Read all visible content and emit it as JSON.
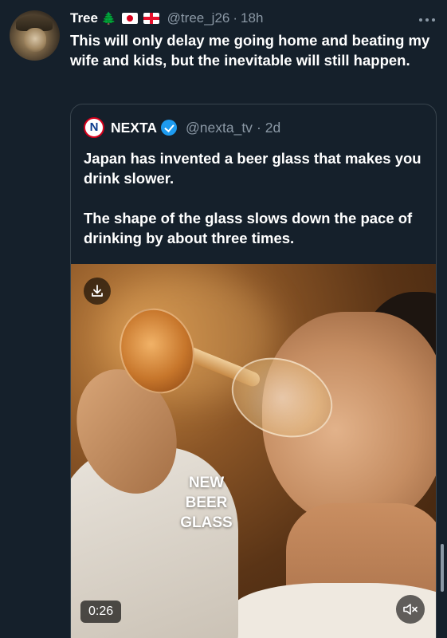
{
  "tweet": {
    "display_name": "Tree",
    "tree_emoji": "🌲",
    "flags": [
      "japan-flag-icon",
      "georgia-flag-icon"
    ],
    "handle": "@tree_j26",
    "separator": "·",
    "time": "18h",
    "more_icon": "more-options-icon",
    "text": "This will only delay me going home and beating my wife and kids, but the inevitable will still happen."
  },
  "quote": {
    "logo_letter": "N",
    "display_name": "NEXTA",
    "verified_icon": "verified-badge-icon",
    "handle": "@nexta_tv",
    "separator": "·",
    "time": "2d",
    "paragraphs": [
      "Japan has invented a beer glass that makes you drink slower.",
      "The shape of the glass slows down the pace of drinking by about three times."
    ],
    "media": {
      "overlay_lines": [
        "NEW",
        "BEER",
        "GLASS"
      ],
      "duration": "0:26",
      "download_icon": "download-icon",
      "volume_icon": "volume-muted-icon"
    }
  },
  "colors": {
    "background": "#15202b",
    "secondary_text": "#8b98a5",
    "border": "#38444d",
    "verified": "#1d9bf0"
  }
}
